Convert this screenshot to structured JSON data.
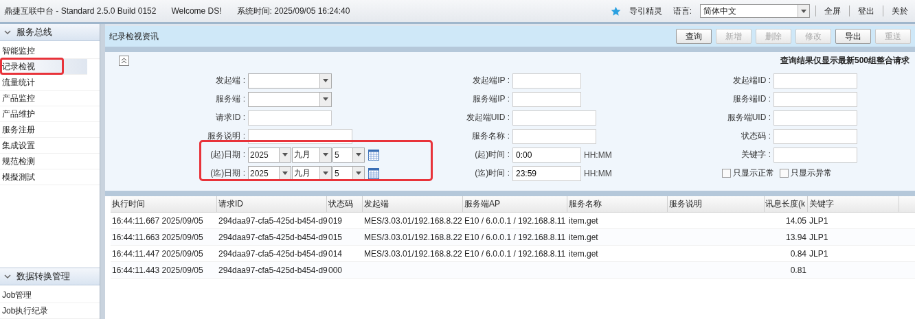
{
  "top_bar": {
    "title": "鼎捷互联中台 - Standard 2.5.0 Build 0152",
    "welcome": "Welcome DS!",
    "system_time": "系统时间: 2025/09/05 16:24:40",
    "guide": "导引精灵",
    "language_label": "语言:",
    "language": "简体中文",
    "links": [
      "全屏",
      "登出",
      "关於"
    ]
  },
  "sidebar": {
    "sections": [
      {
        "title": "服务总线",
        "expanded": true,
        "items": [
          {
            "label": "智能监控",
            "selected": false,
            "highlight": false
          },
          {
            "label": "记录检视",
            "selected": true,
            "highlight": true
          },
          {
            "label": "流量统计",
            "selected": false,
            "highlight": false
          },
          {
            "label": "产品监控",
            "selected": false,
            "highlight": false
          },
          {
            "label": "产品维护",
            "selected": false,
            "highlight": false
          },
          {
            "label": "服务注册",
            "selected": false,
            "highlight": false
          },
          {
            "label": "集成设置",
            "selected": false,
            "highlight": false
          },
          {
            "label": "规范检测",
            "selected": false,
            "highlight": false
          },
          {
            "label": "模擬測試",
            "selected": false,
            "highlight": false
          }
        ]
      },
      {
        "title": "数据转换管理",
        "expanded": true,
        "items": [
          {
            "label": "Job管理",
            "selected": false,
            "highlight": false
          },
          {
            "label": "Job执行纪录",
            "selected": false,
            "highlight": false
          }
        ]
      }
    ]
  },
  "panel": {
    "title": "纪录检视资讯",
    "buttons": [
      {
        "label": "查询",
        "disabled": false
      },
      {
        "label": "新增",
        "disabled": true
      },
      {
        "label": "删除",
        "disabled": true
      },
      {
        "label": "修改",
        "disabled": true
      },
      {
        "label": "导出",
        "disabled": false
      },
      {
        "label": "重送",
        "disabled": true
      }
    ]
  },
  "form": {
    "note": "查询结果仅显示最新500组整合请求",
    "dates_highlighted": true,
    "columns": [
      [
        {
          "kind": "select",
          "label": "发起端 :"
        },
        {
          "kind": "select",
          "label": "服务端 :"
        },
        {
          "kind": "input",
          "label": "请求ID :"
        },
        {
          "kind": "wide",
          "label": "服务说明 :"
        },
        {
          "kind": "date",
          "label": "(起)日期 :",
          "year": "2025",
          "month": "九月",
          "day": "5"
        },
        {
          "kind": "date",
          "label": "(迄)日期 :",
          "year": "2025",
          "month": "九月",
          "day": "5"
        }
      ],
      [
        {
          "kind": "input",
          "label": "发起端IP :"
        },
        {
          "kind": "input",
          "label": "服务端IP :"
        },
        {
          "kind": "wide",
          "label": "发起端UID :"
        },
        {
          "kind": "wide",
          "label": "服务名称 :"
        },
        {
          "kind": "time",
          "label": "(起)时间 :",
          "value": "0:00",
          "hint": "HH:MM"
        },
        {
          "kind": "time",
          "label": "(迄)时间 :",
          "value": "23:59",
          "hint": "HH:MM"
        }
      ],
      [
        {
          "kind": "input",
          "label": "发起端ID :"
        },
        {
          "kind": "input",
          "label": "服务端ID :"
        },
        {
          "kind": "input",
          "label": "服务端UID :"
        },
        {
          "kind": "input",
          "label": "状态码 :"
        },
        {
          "kind": "input",
          "label": "关键字 :"
        },
        {
          "kind": "checks",
          "options": [
            {
              "label": "只显示正常",
              "checked": false
            },
            {
              "label": "只显示异常",
              "checked": false
            }
          ]
        }
      ]
    ]
  },
  "table": {
    "columns": [
      {
        "label": "执行时间",
        "kind": "text"
      },
      {
        "label": "请求ID",
        "kind": "text"
      },
      {
        "label": "状态码",
        "kind": "text"
      },
      {
        "label": "发起端",
        "kind": "text"
      },
      {
        "label": "服务端AP",
        "kind": "text"
      },
      {
        "label": "服务名称",
        "kind": "text"
      },
      {
        "label": "服务说明",
        "kind": "text"
      },
      {
        "label": "讯息长度(k",
        "kind": "number"
      },
      {
        "label": "关键字",
        "kind": "text"
      }
    ],
    "rows": [
      [
        "16:44:11.667 2025/09/05",
        "294daa97-cfa5-425d-b454-d9",
        "019",
        "MES/3.03.01/192.168.8.22",
        "E10 / 6.0.0.1 / 192.168.8.11",
        "item.get",
        "",
        "14.05",
        "JLP1"
      ],
      [
        "16:44:11.663 2025/09/05",
        "294daa97-cfa5-425d-b454-d9",
        "015",
        "MES/3.03.01/192.168.8.22",
        "E10 / 6.0.0.1 / 192.168.8.11",
        "item.get",
        "",
        "13.94",
        "JLP1"
      ],
      [
        "16:44:11.447 2025/09/05",
        "294daa97-cfa5-425d-b454-d9",
        "014",
        "MES/3.03.01/192.168.8.22",
        "E10 / 6.0.0.1 / 192.168.8.11",
        "item.get",
        "",
        "0.84",
        "JLP1"
      ],
      [
        "16:44:11.443 2025/09/05",
        "294daa97-cfa5-425d-b454-d9",
        "000",
        "",
        "",
        "",
        "",
        "0.81",
        ""
      ]
    ]
  }
}
